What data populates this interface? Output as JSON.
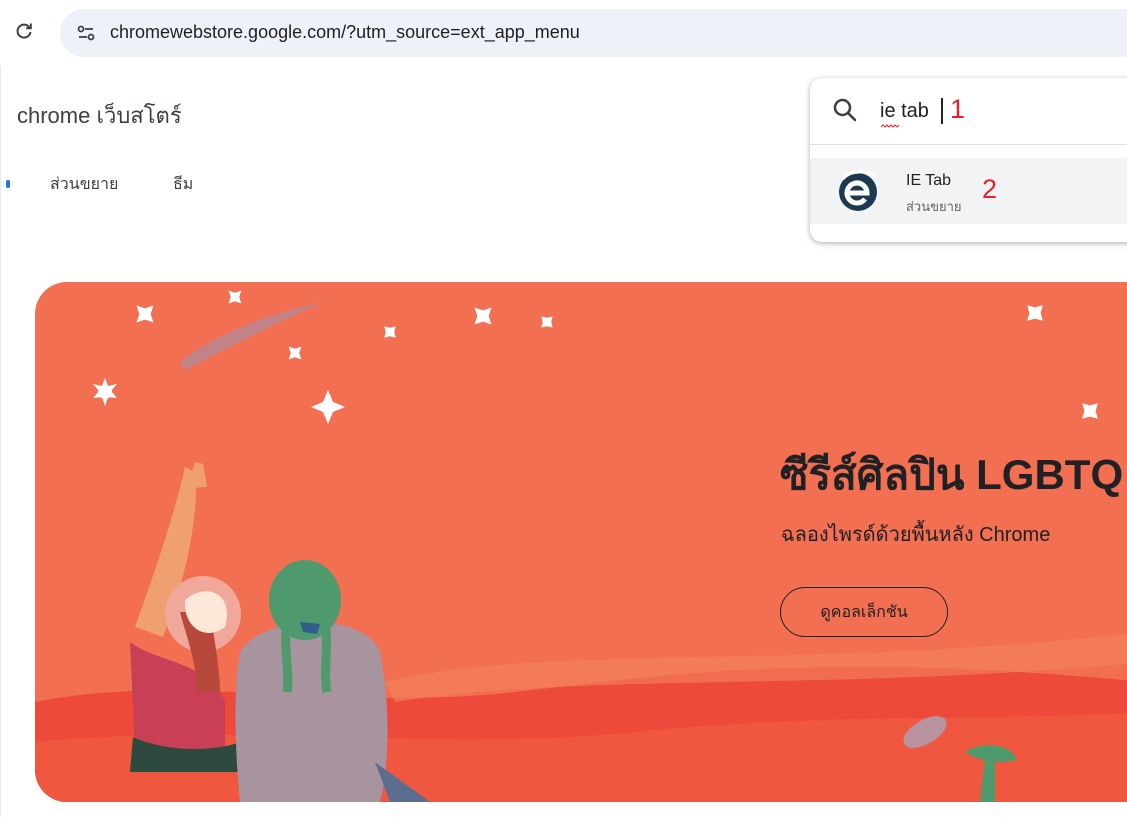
{
  "browser": {
    "url": "chromewebstore.google.com/?utm_source=ext_app_menu",
    "reload_icon": "reload-icon",
    "site_info_icon": "tune-icon"
  },
  "store": {
    "logo_text": "chrome เว็บสโตร์",
    "nav_tabs": [
      {
        "label": "ส่วนขยาย"
      },
      {
        "label": "ธีม"
      }
    ]
  },
  "search": {
    "value": "ie tab",
    "annotation": "1",
    "suggestion": {
      "title": "IE Tab",
      "subtitle": "ส่วนขยาย",
      "annotation": "2",
      "icon": "ie-tab-icon"
    }
  },
  "banner": {
    "title": "ซีรีส์ศิลปิน LGBTQ",
    "subtitle": "ฉลองไพรด์ด้วยพื้นหลัง Chrome",
    "button_label": "ดูคอลเล็กชัน",
    "background_color": "#f26f52"
  },
  "colors": {
    "annotation_red": "#e8202a",
    "accent_blue": "#1a73e8"
  }
}
